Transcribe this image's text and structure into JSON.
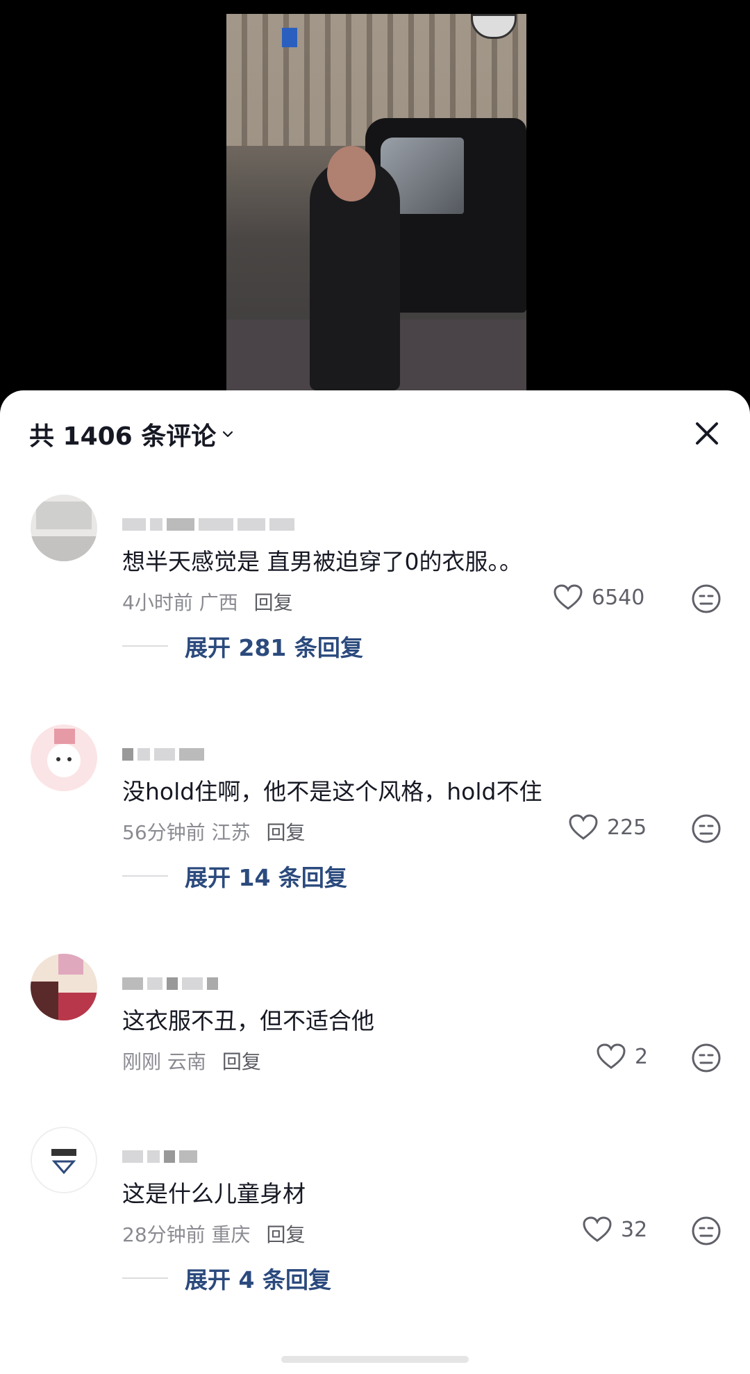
{
  "header": {
    "title": "共 1406 条评论"
  },
  "comments": [
    {
      "text": "想半天感觉是 直男被迫穿了0的衣服。。",
      "time": "4小时前",
      "location": "广西",
      "reply": "回复",
      "likes": "6540",
      "expand": "展开 281 条回复"
    },
    {
      "text": "没hold住啊，他不是这个风格，hold不住",
      "time": "56分钟前",
      "location": "江苏",
      "reply": "回复",
      "likes": "225",
      "expand": "展开 14 条回复"
    },
    {
      "text": "这衣服不丑，但不适合他",
      "time": "刚刚",
      "location": "云南",
      "reply": "回复",
      "likes": "2"
    },
    {
      "text": "这是什么儿童身材",
      "time": "28分钟前",
      "location": "重庆",
      "reply": "回复",
      "likes": "32",
      "expand": "展开 4 条回复"
    }
  ]
}
